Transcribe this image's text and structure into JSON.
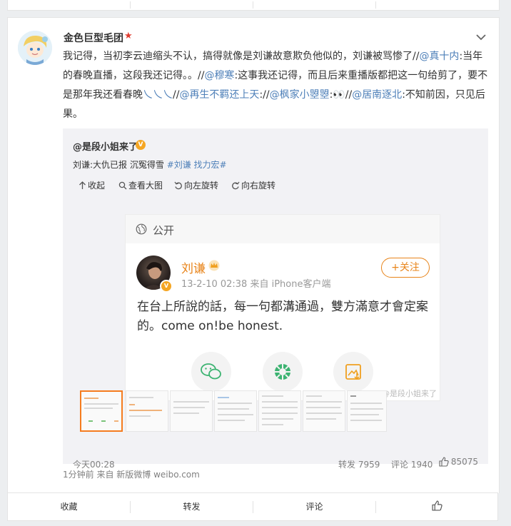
{
  "post": {
    "author": "金色巨型毛团",
    "text": {
      "p1": "我记得，当初李云迪缩头不认，搞得就像是刘谦故意欺负他似的，刘谦被骂惨了//",
      "m1": "@真十内",
      "p2": ":当年的春晚直播，这段我还记得。。//",
      "m2": "@穆寒",
      "p3": ":这事我还记得，而且后来重播版都把这一句给剪了，要不是那年我还看春晚",
      "slash": "乀乀乀",
      "p4": "//",
      "m3": "@再生不羁还上天",
      "p5": "://",
      "m4": "@枫家小曌曌",
      "p6": ":",
      "emoji": "👀",
      "p7": "//",
      "m5": "@居南逐北",
      "p8": ":不知前因，只见后果。"
    },
    "time": "1分钟前",
    "source": "来自 新版微博 weibo.com"
  },
  "repost": {
    "author": "@是段小姐来了",
    "badge": "V",
    "text_plain": "刘谦:大仇已报 沉冤得雪 ",
    "text_tag": "#刘谦 找力宏#",
    "toolbar": {
      "collapse": "收起",
      "view_large": "查看大图",
      "rotate_left": "向左旋转",
      "rotate_right": "向右旋转"
    },
    "time": "今天00:28",
    "stats": {
      "forward": "转发 7959",
      "comment": "评论 1940",
      "likes": "85075"
    }
  },
  "screenshot": {
    "visibility": "公开",
    "name": "刘谦",
    "meta": "13-2-10 02:38   来自 iPhone客户端",
    "follow": "+关注",
    "text": "在台上所說的話，每一句都溝通過，雙方滿意才會定案的。come on!be honest.",
    "watermark": "@是段小姐来了"
  },
  "actions": {
    "favorite": "收藏",
    "forward": "转发",
    "comment": "评论"
  },
  "colors": {
    "link": "#4d7fb8",
    "accent_orange": "#e8841a",
    "vip_red": "#e03c2f"
  }
}
